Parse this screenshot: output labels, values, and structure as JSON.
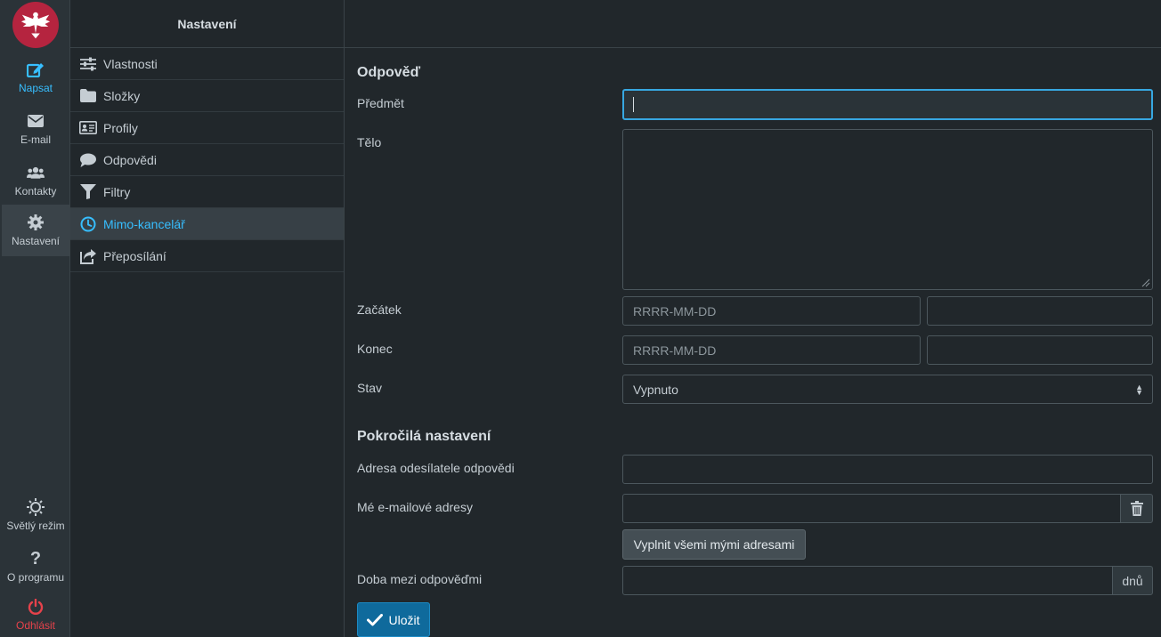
{
  "rail": {
    "items": [
      {
        "label": "Napsat",
        "icon": "compose-icon"
      },
      {
        "label": "E-mail",
        "icon": "envelope-icon"
      },
      {
        "label": "Kontakty",
        "icon": "contacts-icon"
      },
      {
        "label": "Nastavení",
        "icon": "gear-icon"
      },
      {
        "label": "Světlý režim",
        "icon": "sun-icon"
      },
      {
        "label": "O programu",
        "icon": "question-icon"
      },
      {
        "label": "Odhlásit",
        "icon": "power-icon"
      }
    ]
  },
  "settings": {
    "title": "Nastavení",
    "items": [
      {
        "label": "Vlastnosti",
        "icon": "sliders-icon"
      },
      {
        "label": "Složky",
        "icon": "folder-icon"
      },
      {
        "label": "Profily",
        "icon": "id-card-icon"
      },
      {
        "label": "Odpovědi",
        "icon": "speech-bubble-icon"
      },
      {
        "label": "Filtry",
        "icon": "filter-icon"
      },
      {
        "label": "Mimo-kancelář",
        "icon": "clock-icon"
      },
      {
        "label": "Přeposílání",
        "icon": "share-icon"
      }
    ]
  },
  "form": {
    "title": "Odpověď",
    "subject_label": "Předmět",
    "subject_value": "",
    "body_label": "Tělo",
    "body_value": "",
    "start_label": "Začátek",
    "start_placeholder": "RRRR-MM-DD",
    "end_label": "Konec",
    "end_placeholder": "RRRR-MM-DD",
    "status_label": "Stav",
    "status_value": "Vypnuto",
    "advanced_title": "Pokročilá nastavení",
    "sender_label": "Adresa odesílatele odpovědi",
    "my_addresses_label": "Mé e-mailové adresy",
    "fill_button": "Vyplnit všemi mými adresami",
    "interval_label": "Doba mezi odpověďmi",
    "interval_unit": "dnů",
    "save_button": "Uložit"
  },
  "colors": {
    "accent": "#37beff",
    "logout": "#e6424b",
    "logo": "#b5243f",
    "save": "#0f6a9c"
  }
}
